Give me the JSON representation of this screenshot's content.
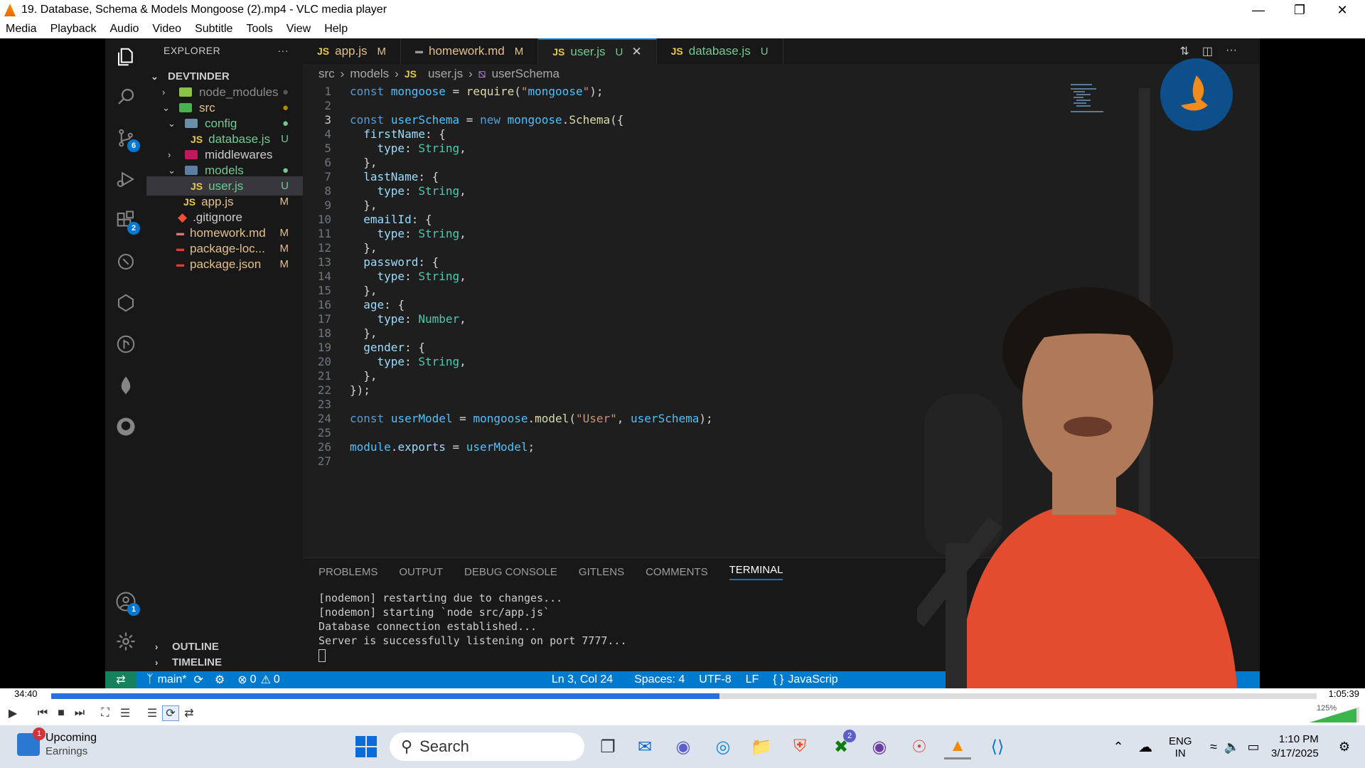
{
  "window": {
    "title": "19. Database, Schema & Models  Mongoose (2).mp4 - VLC media player",
    "menu": [
      "Media",
      "Playback",
      "Audio",
      "Video",
      "Subtitle",
      "Tools",
      "View",
      "Help"
    ]
  },
  "vscode": {
    "explorer_title": "EXPLORER",
    "project": "DEVTINDER",
    "tree": [
      {
        "name": "node_modules",
        "status": ""
      },
      {
        "name": "src",
        "status": ""
      },
      {
        "name": "config",
        "status": ""
      },
      {
        "name": "database.js",
        "status": "U"
      },
      {
        "name": "middlewares",
        "status": ""
      },
      {
        "name": "models",
        "status": ""
      },
      {
        "name": "user.js",
        "status": "U"
      },
      {
        "name": "app.js",
        "status": "M"
      },
      {
        "name": ".gitignore",
        "status": ""
      },
      {
        "name": "homework.md",
        "status": "M"
      },
      {
        "name": "package-loc...",
        "status": "M"
      },
      {
        "name": "package.json",
        "status": "M"
      }
    ],
    "js_badge": "JS",
    "tabs": [
      {
        "label": "app.js",
        "mod": "M"
      },
      {
        "label": "homework.md",
        "mod": "M"
      },
      {
        "label": "user.js",
        "mod": "U"
      },
      {
        "label": "database.js",
        "mod": "U"
      }
    ],
    "breadcrumb": [
      "src",
      "models",
      "user.js",
      "userSchema"
    ],
    "code_lines": [
      "const mongoose = require(\"mongoose\");",
      "",
      "const userSchema = new mongoose.Schema({",
      "  firstName: {",
      "    type: String,",
      "  },",
      "  lastName: {",
      "    type: String,",
      "  },",
      "  emailId: {",
      "    type: String,",
      "  },",
      "  password: {",
      "    type: String,",
      "  },",
      "  age: {",
      "    type: Number,",
      "  },",
      "  gender: {",
      "    type: String,",
      "  },",
      "});",
      "",
      "const userModel = mongoose.model(\"User\", userSchema);",
      "",
      "module.exports = userModel;",
      ""
    ],
    "panel_tabs": [
      "PROBLEMS",
      "OUTPUT",
      "DEBUG CONSOLE",
      "GITLENS",
      "COMMENTS",
      "TERMINAL"
    ],
    "terminal": [
      "[nodemon] restarting due to changes...",
      "[nodemon] starting `node src/app.js`",
      "Database connection established...",
      "Server is successfully listening on port 7777..."
    ],
    "outline": "OUTLINE",
    "timeline": "TIMELINE",
    "status": {
      "branch": "main*",
      "errors": "0",
      "warnings": "0",
      "position": "Ln 3, Col 24",
      "spaces": "Spaces: 4",
      "encoding": "UTF-8",
      "eol": "LF",
      "language": "JavaScrip"
    },
    "badges": {
      "scm": "6",
      "extensions": "2",
      "accounts": "1"
    }
  },
  "player": {
    "elapsed": "34:40",
    "total": "1:05:39",
    "progress": 0.528,
    "volume": "125%"
  },
  "taskbar": {
    "widget_title": "Upcoming",
    "widget_sub": "Earnings",
    "widget_badge": "1",
    "search": "Search",
    "lang": "ENG",
    "region": "IN",
    "time": "1:10 PM",
    "date": "3/17/2025",
    "xbox_badge": "2"
  }
}
